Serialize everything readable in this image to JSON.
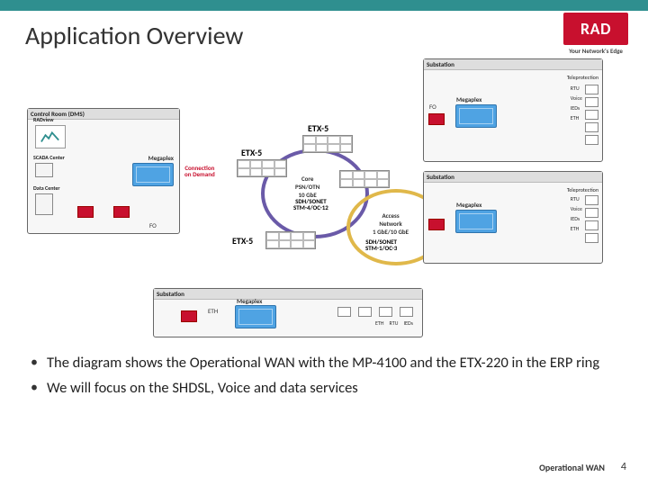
{
  "header": {
    "title": "Application Overview",
    "logo_text": "RAD",
    "logo_tagline": "Your Network's Edge"
  },
  "diagram": {
    "areas": {
      "control_room": "Control Room (DMS)",
      "substation1": "Substation",
      "substation2": "Substation",
      "substation3": "Substation"
    },
    "megaplex": "Megaplex",
    "radview": "RADview",
    "scada": "SCADA Center",
    "datacenter": "Data Center",
    "cod": "Connection\non Demand",
    "fo": "FO",
    "eth": "ETH",
    "core_ring": "Core\nPSN/OTN\n10 GbE",
    "access_ring": "Access\nNetwork\n1 GbE/10 GbE",
    "sdh_core": "SDH/SONET\nSTM-4/OC-12",
    "sdh_access": "SDH/SONET\nSTM-1/OC-3",
    "etx5": "ETX-5",
    "sub_items": {
      "teleprotection": "Teleprotection",
      "rtu": "RTU",
      "voice": "Voice",
      "ieds": "IEDs",
      "eth": "ETH"
    }
  },
  "bullets": [
    "The diagram shows the Operational WAN with the MP-4100 and the ETX-220 in the ERP ring",
    "We will focus on the SHDSL, Voice and data services"
  ],
  "footer": {
    "label": "Operational WAN",
    "page": "4"
  }
}
